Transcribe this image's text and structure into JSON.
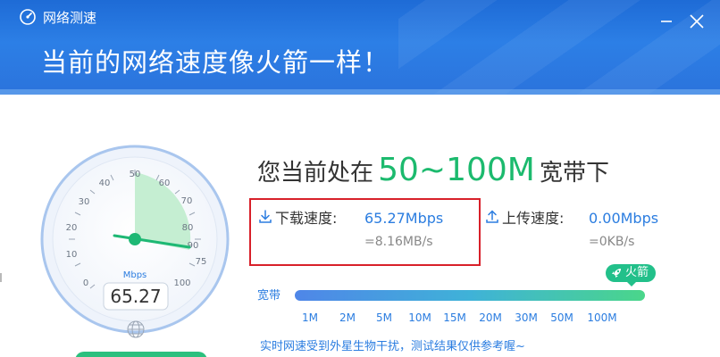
{
  "window": {
    "title": "网络测速",
    "headline": "当前的网络速度像火箭一样！"
  },
  "gauge": {
    "unit": "Mbps",
    "value": "65.27",
    "value_numeric": 65.27,
    "scale_labels": [
      "0",
      "10",
      "20",
      "30",
      "40",
      "50",
      "60",
      "70",
      "75",
      "80",
      "90",
      "100"
    ]
  },
  "bandwidth": {
    "prefix": "您当前处在",
    "range": "50~100M",
    "suffix": "宽带下",
    "bar_label": "宽带",
    "badge": "火箭",
    "ticks": [
      "1M",
      "2M",
      "5M",
      "10M",
      "15M",
      "20M",
      "30M",
      "50M",
      "100M"
    ]
  },
  "download": {
    "label": "下载速度:",
    "value": "65.27Mbps",
    "sub": "=8.16MB/s"
  },
  "upload": {
    "label": "上传速度:",
    "value": "0.00Mbps",
    "sub": "=0KB/s"
  },
  "disclaimer": "实时网速受到外星生物干扰，测试结果仅供参考喔~",
  "colors": {
    "header": "#2b7de0",
    "accent_green": "#1cba6e",
    "link_blue": "#2b7de0",
    "highlight_box": "#d8202a"
  },
  "icons": {
    "app": "globe-speed-icon",
    "minimize": "minimize-icon",
    "close": "close-icon",
    "download": "download-icon",
    "upload": "upload-icon",
    "rocket": "rocket-icon",
    "globe": "globe-icon"
  }
}
